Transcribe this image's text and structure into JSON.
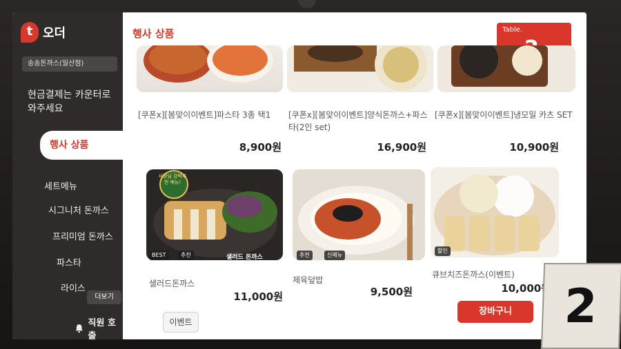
{
  "app": {
    "logo_text": "오더",
    "store_name": "송송돈까스(일산점)",
    "notice": "현금결제는 카운터로 와주세요"
  },
  "sidebar": {
    "active_label": "행사 상품",
    "items": [
      {
        "label": "세트메뉴"
      },
      {
        "label": "시그니처 돈까스"
      },
      {
        "label": "프리미엄 돈까스"
      },
      {
        "label": "파스타"
      },
      {
        "label": "라이스"
      }
    ],
    "more_label": "더보기",
    "call_label": "직원 호출"
  },
  "main": {
    "section_title": "행사 상품",
    "table_label": "Table.",
    "table_number": "2",
    "event_label": "이벤트",
    "cart_label": "장바구니"
  },
  "products": [
    {
      "name": "[쿠폰x][봄맞이이벤트]파스타 3종 택1",
      "price": "8,900원",
      "tags": []
    },
    {
      "name": "[쿠폰x][봄맞이이벤트]양식돈까스+파스타(2인 set)",
      "price": "16,900원",
      "tags": []
    },
    {
      "name": "[쿠폰x][봄맞이이벤트]냉모밀 카츠 SET",
      "price": "10,900원",
      "tags": []
    },
    {
      "name": "샐러드돈까스",
      "price": "11,000원",
      "tags": [
        "BEST",
        "추천"
      ],
      "badge": "사장님 강력추천 메뉴!",
      "overlay": "샐러드 돈까스"
    },
    {
      "name": "제육덮밥",
      "price": "9,500원",
      "tags": [
        "추천",
        "신메뉴"
      ]
    },
    {
      "name": "큐브치즈돈까스(이벤트)",
      "price": "10,000원",
      "tags": [
        "할인"
      ]
    }
  ],
  "physical_table_number": "2"
}
